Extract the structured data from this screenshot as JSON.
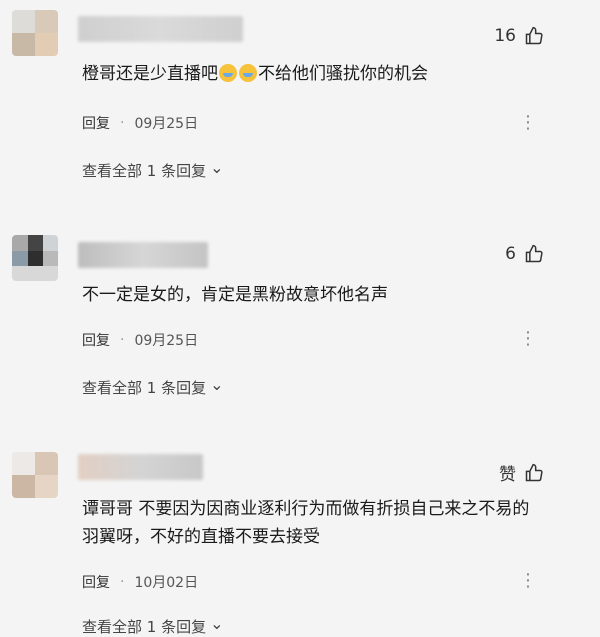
{
  "comments": [
    {
      "like_count": "16",
      "text_before_emoji": "橙哥还是少直播吧",
      "text_after_emoji": "不给他们骚扰你的机会",
      "emoji": "crying-emoji",
      "reply_label": "回复",
      "date": "09月25日",
      "view_all_label": "查看全部 1 条回复",
      "more_glyph": "⋮"
    },
    {
      "like_count": "6",
      "text": "不一定是女的，肯定是黑粉故意坏他名声",
      "reply_label": "回复",
      "date": "09月25日",
      "view_all_label": "查看全部 1 条回复",
      "more_glyph": "⋮"
    },
    {
      "like_label": "赞",
      "text": "谭哥哥 不要因为因商业逐利行为而做有折损自己来之不易的羽翼呀，不好的直播不要去接受",
      "reply_label": "回复",
      "date": "10月02日",
      "view_all_label": "查看全部 1 条回复",
      "more_glyph": "⋮"
    }
  ],
  "icons": {
    "thumb": "thumbs-up-icon",
    "chevron": "chevron-down-icon"
  },
  "chevron_glyph": "⌄",
  "dot_glyph": "·"
}
